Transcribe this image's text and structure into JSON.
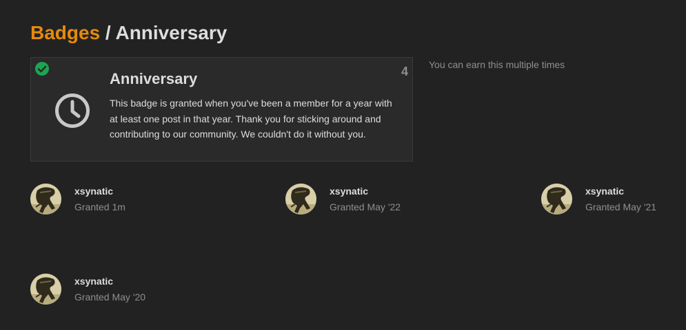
{
  "breadcrumb": {
    "link_label": "Badges",
    "separator": " / ",
    "current": "Anniversary"
  },
  "badge": {
    "name": "Anniversary",
    "grant_count": "4",
    "description": "This badge is granted when you've been a member for a year with at least one post in that year. Thank you for sticking around and contributing to our community. We couldn't do it without you.",
    "icon": "clock-icon",
    "granted_icon": "check-circle-icon"
  },
  "earn_note": "You can earn this multiple times",
  "grants": [
    {
      "username": "xsynatic",
      "granted": "Granted 1m"
    },
    {
      "username": "xsynatic",
      "granted": "Granted May '22"
    },
    {
      "username": "xsynatic",
      "granted": "Granted May '21"
    },
    {
      "username": "xsynatic",
      "granted": "Granted May '20"
    }
  ],
  "colors": {
    "background": "#222222",
    "accent": "#e68a0c",
    "text": "#dddddd",
    "muted": "#8f8f8f",
    "success": "#1ca551",
    "card": "#2a2a2a"
  }
}
